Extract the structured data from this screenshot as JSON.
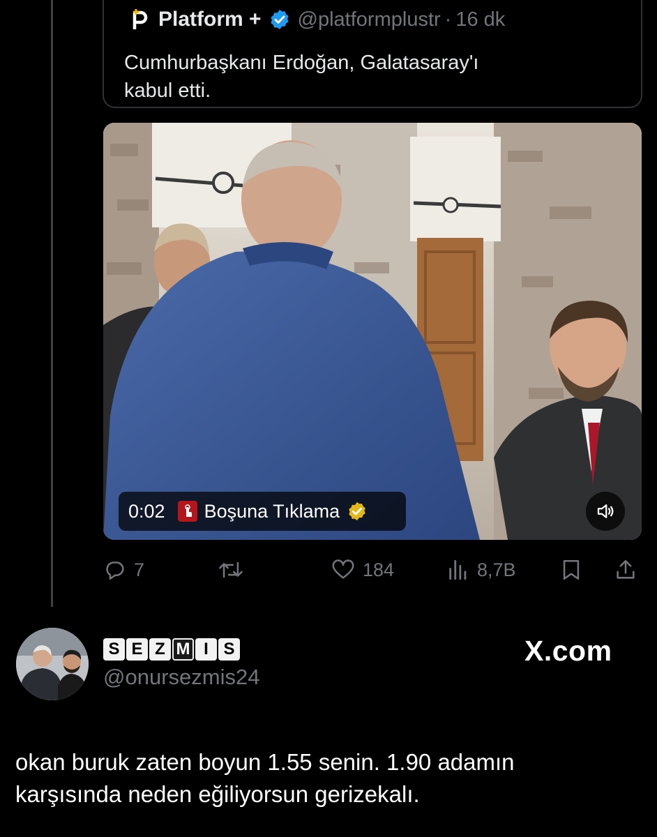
{
  "quoted_tweet": {
    "display_name": "Platform +",
    "handle": "@platformplustr",
    "separator": "·",
    "time": "16 dk",
    "text_line1": "Cumhurbaşkanı Erdoğan, Galatasaray'ı",
    "text_line2": "kabul etti.",
    "logo_icon": "platform-p-icon",
    "verified_icon": "verified-badge-icon",
    "verified_color": "#1d9bf0"
  },
  "video": {
    "time": "0:02",
    "channel_name": "Boşuna Tıklama",
    "channel_icon": "tap-icon",
    "channel_badge": "gold-verified-icon",
    "volume_icon": "volume-icon"
  },
  "actions": {
    "replies": "7",
    "likes": "184",
    "views": "8,7B",
    "reply_icon": "reply-icon",
    "retweet_icon": "retweet-icon",
    "like_icon": "heart-icon",
    "views_icon": "views-icon",
    "bookmark_icon": "bookmark-icon",
    "share_icon": "share-icon"
  },
  "reply_tweet": {
    "display_name_letters": [
      "S",
      "E",
      "Z",
      "M",
      "I",
      "S"
    ],
    "handle": "@onursezmis24",
    "watermark": "X.com",
    "text_line1": "okan buruk zaten boyun 1.55 senin. 1.90 adamın",
    "text_line2": "karşısında neden eğiliyorsun gerizekalı."
  },
  "colors": {
    "background": "#000000",
    "muted": "#71767b",
    "text": "#e7e9ea",
    "border": "#2f3336"
  }
}
